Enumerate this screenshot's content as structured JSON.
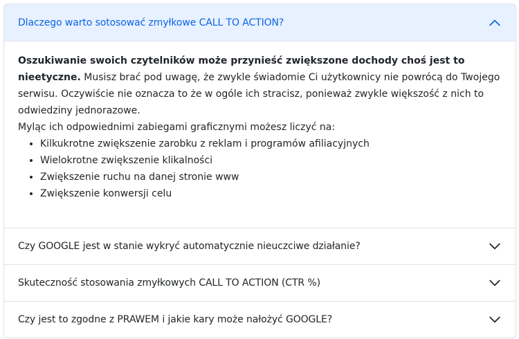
{
  "accordion": {
    "items": [
      {
        "title": "Dlaczego warto sotosować zmyłkowe CALL TO ACTION?",
        "expanded": true,
        "body": {
          "bold_lead": "Oszukiwanie swoich czytelników może przynieść zwiększone dochody choś jest to nieetyczne.",
          "text1": " Musisz brać pod uwagę, że zwykle świadomie Ci użytkownicy nie powrócą do Twojego serwisu. Oczywiście nie oznacza to że w ogóle ich stracisz, ponieważ zwykle większość z nich to odwiedziny jednorazowe.",
          "text2": "Myląc ich odpowiednimi zabiegami graficznymi możesz liczyć na:",
          "bullets": [
            "Kilkukrotne zwiększenie zarobku z reklam i programów afiliacyjnych",
            "Wielokrotne zwiększenie klikalności",
            "Zwiększenie ruchu na danej stronie www",
            "Zwiększenie konwersji celu"
          ]
        }
      },
      {
        "title": "Czy GOOGLE jest w stanie wykryć automatycznie nieuczciwe działanie?",
        "expanded": false
      },
      {
        "title": "Skuteczność stosowania zmyłkowych CALL TO ACTION (CTR %)",
        "expanded": false
      },
      {
        "title": "Czy jest to zgodne z PRAWEM i jakie kary może nałożyć GOOGLE?",
        "expanded": false
      }
    ]
  },
  "icons": {
    "expanded": "chevron-up-icon",
    "collapsed": "chevron-down-icon"
  },
  "colors": {
    "active_header_bg": "#e7f1ff",
    "active_header_text": "#0c63e4",
    "border": "#dee2e6",
    "text": "#212529"
  }
}
